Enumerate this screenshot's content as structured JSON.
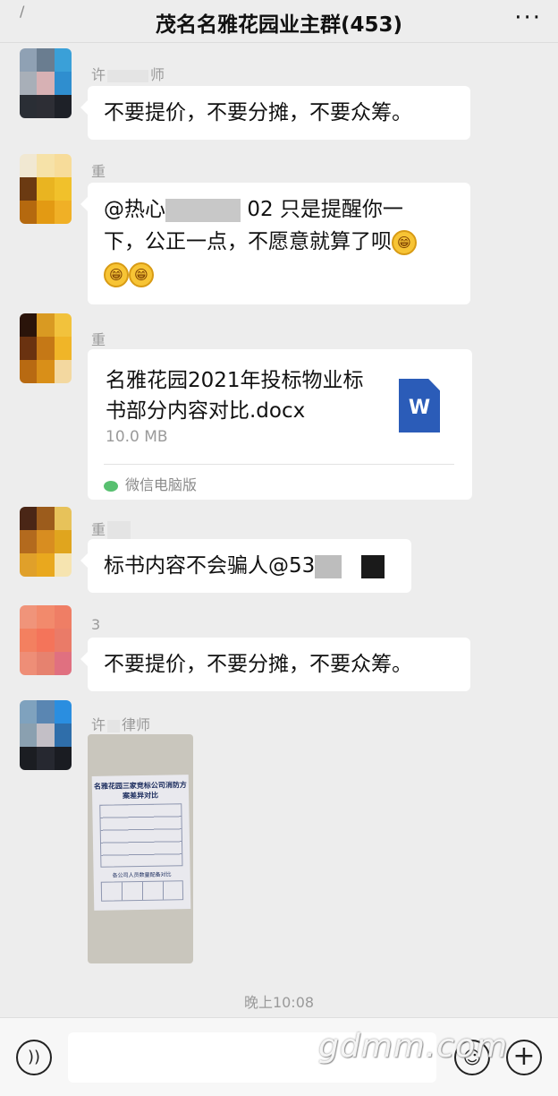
{
  "header": {
    "back_glyph": "/",
    "title": "茂名名雅花园业主群(453)",
    "more_glyph": "···"
  },
  "messages": [
    {
      "sender_prefix": "许",
      "sender_suffix": "师",
      "text": "不要提价，不要分摊，不要众筹。"
    },
    {
      "sender": "重",
      "text_part1": "@热心",
      "text_part2": "02 只是提醒你一",
      "text_part3": "下，公正一点，不愿意就算了呗",
      "emoji_glyph": "😁"
    },
    {
      "sender": "重",
      "file_name": "名雅花园2021年投标物业标书部分内容对比.docx",
      "file_size": "10.0 MB",
      "file_icon_letter": "W",
      "file_source": "微信电脑版"
    },
    {
      "sender": "重",
      "text": "标书内容不会骗人@53"
    },
    {
      "sender": "3",
      "text": "不要提价，不要分摊，不要众筹。"
    },
    {
      "sender_prefix": "许",
      "sender_suffix": "律师",
      "photo_title": "名雅花园三家竞标公司消防方案差异对比",
      "photo_subtitle": "各公司人员数量配备对比"
    }
  ],
  "timestamp": "晚上10:08",
  "bottom": {
    "voice_glyph": "))",
    "emoji_glyph": "☺",
    "plus_glyph": "+",
    "watermark": "gdmm.com"
  },
  "colors": {
    "background": "#ededed",
    "bubble": "#ffffff",
    "word_icon": "#2b5cb8"
  }
}
